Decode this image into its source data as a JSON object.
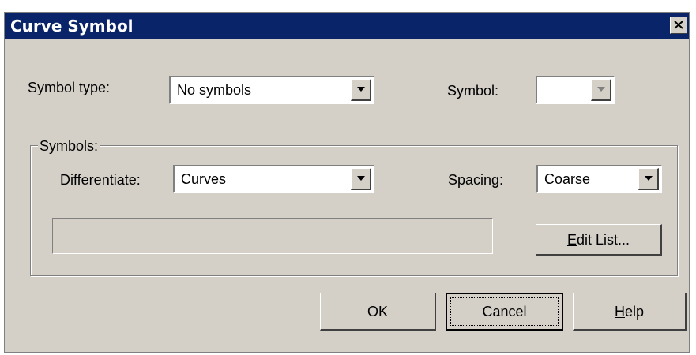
{
  "window": {
    "title": "Curve Symbol"
  },
  "symbol_type": {
    "label": "Symbol type:",
    "value": "No symbols"
  },
  "symbol": {
    "label": "Symbol:",
    "value": ""
  },
  "symbols_group": {
    "label": "Symbols:",
    "differentiate": {
      "label": "Differentiate:",
      "value": "Curves"
    },
    "spacing": {
      "label": "Spacing:",
      "value": "Coarse"
    },
    "edit_list": {
      "mnemonic": "E",
      "rest": "dit List..."
    }
  },
  "buttons": {
    "ok": "OK",
    "cancel": "Cancel",
    "help": {
      "mnemonic": "H",
      "rest": "elp"
    }
  },
  "icons": {
    "close": "close-icon",
    "dropdown": "chevron-down-icon"
  }
}
